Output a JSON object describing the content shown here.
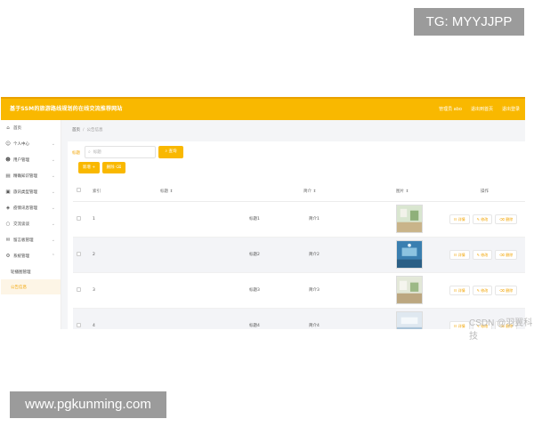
{
  "watermarks": {
    "top": "TG: MYYJJPP",
    "bottom": "www.pgkunming.com",
    "csdn": "CSDN @羽翼科技"
  },
  "app": {
    "title": "基于SSM的旅游路线规划的在线交流推荐网站",
    "topbar_right": [
      "管理员 abo",
      "退出到首页",
      "退出登录"
    ]
  },
  "sidebar": {
    "items": [
      {
        "label": "首页",
        "icon": "home-icon",
        "has_children": false
      },
      {
        "label": "个人中心",
        "icon": "user-icon",
        "has_children": true
      },
      {
        "label": "用户管理",
        "icon": "users-icon",
        "has_children": true
      },
      {
        "label": "精确知识管理",
        "icon": "book-icon",
        "has_children": true
      },
      {
        "label": "旅讯类型管理",
        "icon": "folder-icon",
        "has_children": true
      },
      {
        "label": "疫情讯息管理",
        "icon": "shield-icon",
        "has_children": true
      },
      {
        "label": "交流谈谈",
        "icon": "chat-icon",
        "has_children": true
      },
      {
        "label": "留言板管理",
        "icon": "message-icon",
        "has_children": true
      },
      {
        "label": "系统管理",
        "icon": "gear-icon",
        "has_children": true
      }
    ],
    "sub_items": [
      {
        "label": "轮播图管理",
        "active": false
      },
      {
        "label": "公告信息",
        "active": true
      }
    ]
  },
  "breadcrumb": {
    "home": "首页",
    "current": "公告信息"
  },
  "search": {
    "label": "标题",
    "placeholder": "标题",
    "button": "查询"
  },
  "actions": {
    "add": "新增",
    "delete": "删除"
  },
  "table": {
    "headers": [
      "索引",
      "标题",
      "简介",
      "图片",
      "操作"
    ],
    "rows": [
      {
        "index": "1",
        "title": "标题1",
        "intro": "简介1"
      },
      {
        "index": "2",
        "title": "标题2",
        "intro": "简介2"
      },
      {
        "index": "3",
        "title": "标题3",
        "intro": "简介3"
      },
      {
        "index": "4",
        "title": "标题4",
        "intro": "简介4"
      }
    ],
    "op_labels": {
      "detail": "详情",
      "edit": "修改",
      "delete": "删除"
    }
  }
}
